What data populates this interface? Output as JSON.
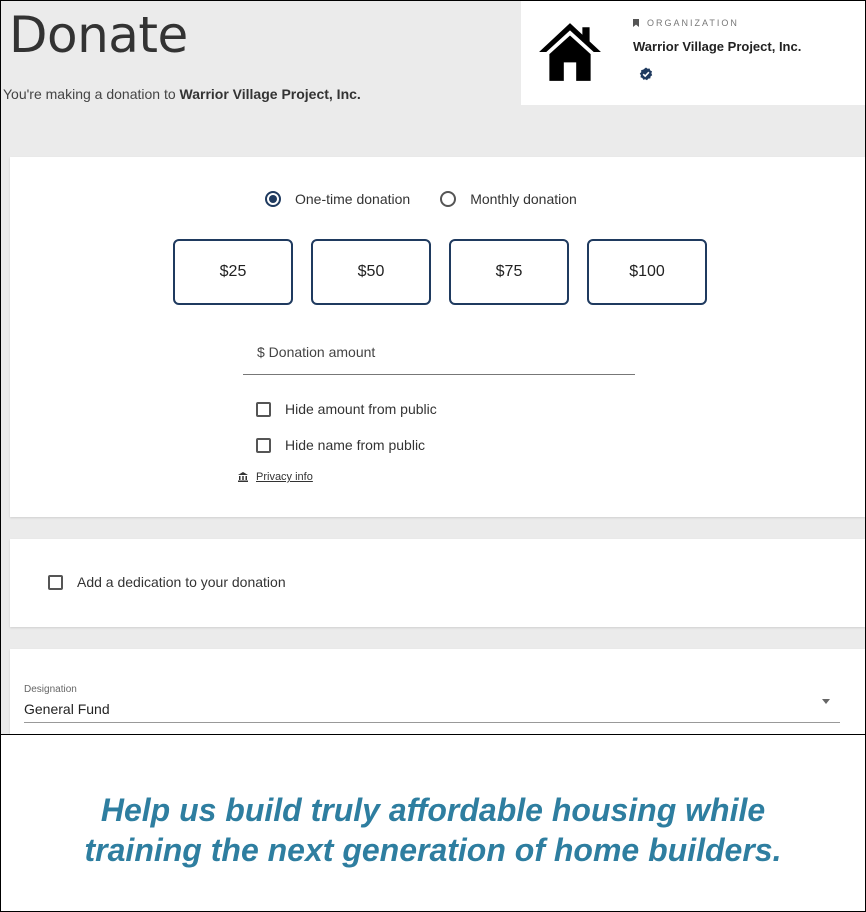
{
  "header": {
    "title": "Donate",
    "subtitle_prefix": "You're making a donation to ",
    "subtitle_org": "Warrior Village Project, Inc."
  },
  "organization": {
    "label": "ORGANIZATION",
    "name": "Warrior Village Project, Inc.",
    "icon": "house-icon",
    "verified_icon": "verified-badge-icon"
  },
  "frequency": {
    "options": [
      {
        "label": "One-time donation",
        "selected": true
      },
      {
        "label": "Monthly donation",
        "selected": false
      }
    ]
  },
  "amounts": [
    "$25",
    "$50",
    "$75",
    "$100"
  ],
  "amount_field": {
    "placeholder": "$ Donation amount",
    "value": ""
  },
  "privacy_options": [
    {
      "label": "Hide amount from public",
      "checked": false
    },
    {
      "label": "Hide name from public",
      "checked": false
    }
  ],
  "privacy_link": "Privacy info",
  "dedication": {
    "label": "Add a dedication to your donation",
    "checked": false
  },
  "designation": {
    "label": "Designation",
    "value": "General Fund"
  },
  "tagline": {
    "line1": "Help us build truly affordable housing while",
    "line2": "training the next generation of home builders."
  },
  "colors": {
    "accent": "#1f3a5f",
    "tagline": "#2e7ea0",
    "background": "#ebebeb"
  }
}
